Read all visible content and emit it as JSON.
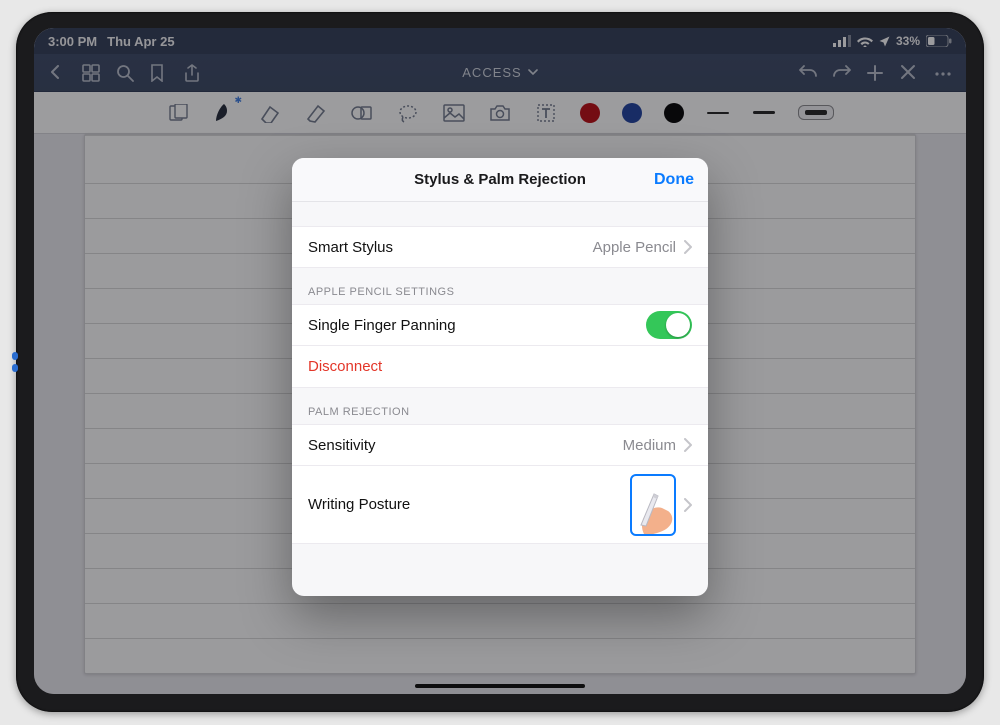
{
  "status": {
    "time": "3:00 PM",
    "date": "Thu Apr 25",
    "battery": "33%"
  },
  "navbar": {
    "title": "ACCESS"
  },
  "sheet": {
    "title": "Stylus & Palm Rejection",
    "done": "Done",
    "smartStylus": {
      "label": "Smart Stylus",
      "value": "Apple Pencil"
    },
    "section1": "APPLE PENCIL SETTINGS",
    "panning": {
      "label": "Single Finger Panning"
    },
    "disconnect": {
      "label": "Disconnect"
    },
    "section2": "PALM REJECTION",
    "sensitivity": {
      "label": "Sensitivity",
      "value": "Medium"
    },
    "posture": {
      "label": "Writing Posture"
    }
  }
}
